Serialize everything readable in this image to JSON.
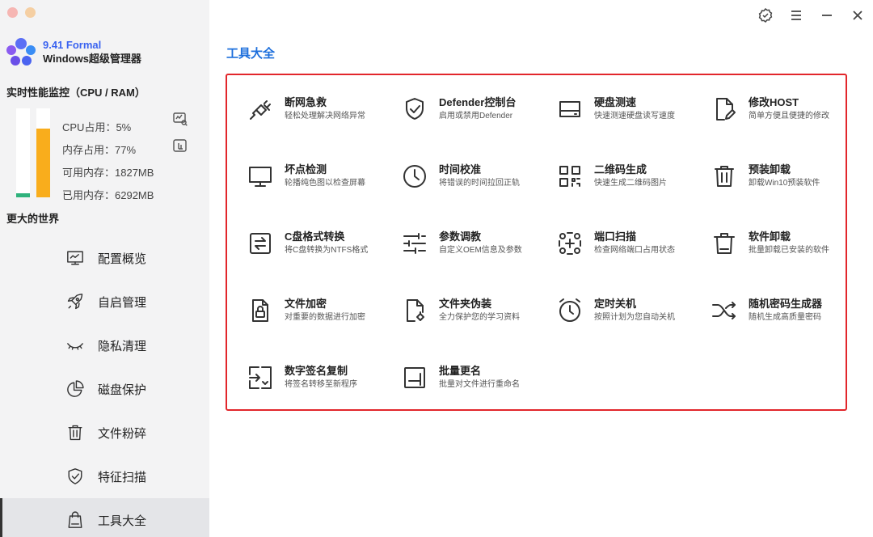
{
  "app": {
    "version": "9.41 Formal",
    "name": "Windows超级管理器"
  },
  "monitor": {
    "title": "实时性能监控（CPU / RAM）",
    "cpu_label": "CPU占用：5%",
    "mem_label": "内存占用：77%",
    "free_label": "可用内存：1827MB",
    "used_label": "已用内存：6292MB",
    "cpu_percent": 5,
    "mem_percent": 77
  },
  "section2_title": "更大的世界",
  "nav": [
    {
      "label": "配置概览",
      "icon": "monitor-chart-icon"
    },
    {
      "label": "自启管理",
      "icon": "rocket-icon"
    },
    {
      "label": "隐私清理",
      "icon": "eye-closed-icon"
    },
    {
      "label": "磁盘保护",
      "icon": "pie-chart-icon"
    },
    {
      "label": "文件粉碎",
      "icon": "trash-icon"
    },
    {
      "label": "特征扫描",
      "icon": "shield-check-icon"
    },
    {
      "label": "工具大全",
      "icon": "bag-icon",
      "active": true
    }
  ],
  "main": {
    "title": "工具大全"
  },
  "tools": [
    {
      "name": "断网急救",
      "desc": "轻松处理解决网络异常",
      "icon": "plug-icon"
    },
    {
      "name": "Defender控制台",
      "desc": "启用或禁用Defender",
      "icon": "shield-icon"
    },
    {
      "name": "硬盘测速",
      "desc": "快速测速硬盘读写速度",
      "icon": "hard-drive-icon"
    },
    {
      "name": "修改HOST",
      "desc": "简单方便且便捷的修改",
      "icon": "file-edit-icon"
    },
    {
      "name": "坏点检测",
      "desc": "轮播纯色图以检查屏幕",
      "icon": "monitor-icon"
    },
    {
      "name": "时间校准",
      "desc": "将错误的时间拉回正轨",
      "icon": "clock-icon"
    },
    {
      "name": "二维码生成",
      "desc": "快速生成二维码图片",
      "icon": "qrcode-icon"
    },
    {
      "name": "预装卸载",
      "desc": "卸载Win10预装软件",
      "icon": "trash-icon"
    },
    {
      "name": "C盘格式转换",
      "desc": "将C盘转换为NTFS格式",
      "icon": "swap-icon"
    },
    {
      "name": "参数调教",
      "desc": "自定义OEM信息及参数",
      "icon": "sliders-icon"
    },
    {
      "name": "端口扫描",
      "desc": "检查网络端口占用状态",
      "icon": "scan-nodes-icon"
    },
    {
      "name": "软件卸载",
      "desc": "批量卸载已安装的软件",
      "icon": "bin-icon"
    },
    {
      "name": "文件加密",
      "desc": "对重要的数据进行加密",
      "icon": "file-lock-icon"
    },
    {
      "name": "文件夹伪装",
      "desc": "全力保护您的学习资料",
      "icon": "file-disguise-icon"
    },
    {
      "name": "定时关机",
      "desc": "按照计划为您自动关机",
      "icon": "alarm-clock-icon"
    },
    {
      "name": "随机密码生成器",
      "desc": "随机生成高质量密码",
      "icon": "shuffle-icon"
    },
    {
      "name": "数字签名复制",
      "desc": "将签名转移至新程序",
      "icon": "signature-transfer-icon"
    },
    {
      "name": "批量更名",
      "desc": "批量对文件进行重命名",
      "icon": "rename-icon"
    }
  ],
  "window": {
    "controls": [
      "badge-check-icon",
      "menu-icon",
      "minimize-icon",
      "close-icon"
    ]
  },
  "colors": {
    "accent": "#1d6fdc",
    "brand": "#3a63f0",
    "highlight_border": "#e2262b",
    "cpu_bar": "#2fb27c",
    "mem_bar": "#f9ad1c"
  }
}
